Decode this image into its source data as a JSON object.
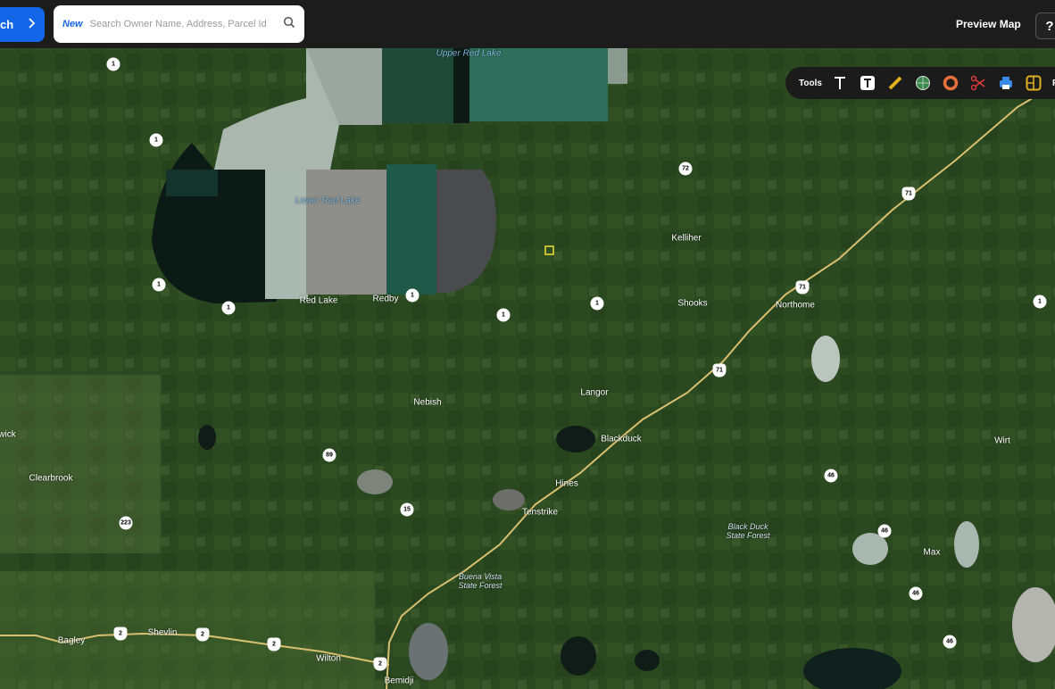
{
  "topbar": {
    "search_button_label": "ch",
    "search_new_tag": "New",
    "search_placeholder": "Search Owner Name, Address, Parcel Id",
    "preview_map_label": "Preview Map",
    "help_label": "?"
  },
  "toolbar": {
    "label": "Tools",
    "tools": [
      "text-tool",
      "text-box-tool",
      "measure-tool",
      "globe-tool",
      "buffer-tool",
      "cut-tool",
      "print-tool",
      "layout-tool"
    ],
    "overflow_label": "P"
  },
  "map": {
    "places": [
      "Red Lake",
      "Redby",
      "Kelliher",
      "Shooks",
      "Northome",
      "Langor",
      "Nebish",
      "Blackduck",
      "Hines",
      "Tenstrike",
      "Wirt",
      "Max",
      "Clearbrook",
      "Bagley",
      "Shevlin",
      "Wilton",
      "Bemidji",
      "wick"
    ],
    "water_labels": [
      "Upper Red Lake",
      "Lower Red Lake"
    ],
    "forest_labels": [
      "Black Duck State Forest",
      "Buena Vista State Forest"
    ],
    "route_shields": [
      "1",
      "1",
      "1",
      "1",
      "1",
      "1",
      "1",
      "1",
      "72",
      "71",
      "71",
      "71",
      "89",
      "15",
      "223",
      "46",
      "46",
      "46",
      "46",
      "2",
      "2",
      "2",
      "2"
    ]
  },
  "colors": {
    "search_blue": "#1466e8",
    "topbar": "#1c1c1c",
    "road": "#d8c070"
  }
}
